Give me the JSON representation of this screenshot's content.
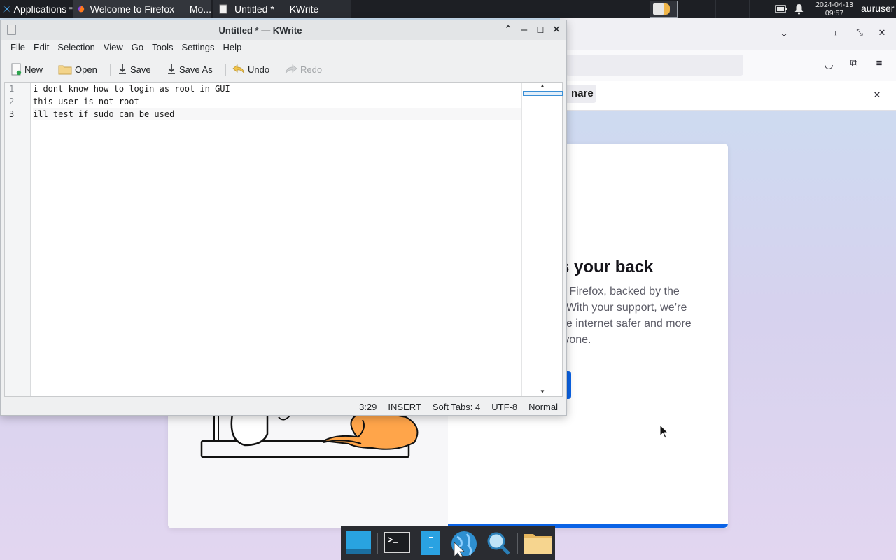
{
  "top_panel": {
    "applications_label": "Applications",
    "tasks": [
      {
        "label": "Welcome to Firefox — Mo...",
        "icon": "firefox-icon"
      },
      {
        "label": "Untitled * — KWrite",
        "icon": "kwrite-icon"
      }
    ],
    "clock_date": "2024-04-13",
    "clock_time": "09:57",
    "username": "auruser"
  },
  "firefox": {
    "share_partial": "nare",
    "welcome_title_partial": "s your back",
    "welcome_body_lines": [
      "g Firefox, backed by the",
      ". With your support, we’re",
      "he internet safer and more",
      "ryone."
    ]
  },
  "kwrite": {
    "title": "Untitled * — KWrite",
    "menu": [
      "File",
      "Edit",
      "Selection",
      "View",
      "Go",
      "Tools",
      "Settings",
      "Help"
    ],
    "toolbar": {
      "new": "New",
      "open": "Open",
      "save": "Save",
      "save_as": "Save As",
      "undo": "Undo",
      "redo": "Redo"
    },
    "line_numbers": [
      "1",
      "2",
      "3"
    ],
    "lines": [
      "i dont know how to login as root in GUI",
      "this user is not root",
      "ill test if sudo can be used"
    ],
    "status": {
      "cursor": "3:29",
      "mode": "INSERT",
      "indent": "Soft Tabs: 4",
      "encoding": "UTF-8",
      "highlight": "Normal"
    }
  },
  "colors": {
    "panel_bg": "#1d1f24",
    "accent_blue": "#0b63e6",
    "window_bg": "#eff0f1"
  }
}
